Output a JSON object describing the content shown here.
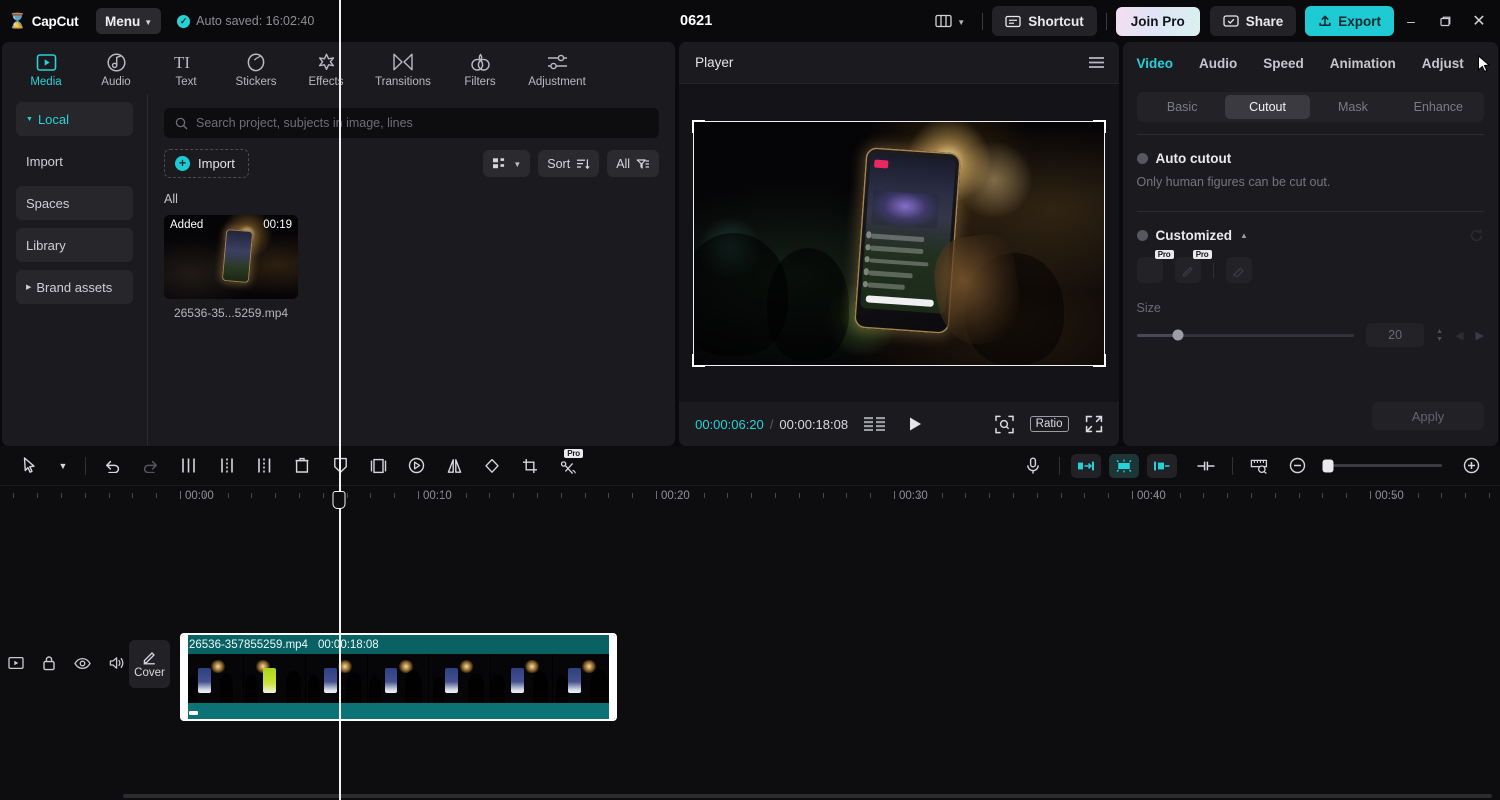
{
  "topbar": {
    "app_name": "CapCut",
    "menu_label": "Menu",
    "autosave": "Auto saved: 16:02:40",
    "project_title": "0621",
    "layout_icon": "layout-icon",
    "shortcut_label": "Shortcut",
    "join_pro_label": "Join Pro",
    "share_label": "Share",
    "export_label": "Export",
    "minimize_icon": "minimize-icon",
    "maximize_icon": "maximize-icon",
    "close_icon": "close-icon"
  },
  "categories": [
    {
      "label": "Media",
      "icon": "media-icon",
      "active": true
    },
    {
      "label": "Audio",
      "icon": "audio-icon",
      "active": false
    },
    {
      "label": "Text",
      "icon": "text-icon",
      "active": false
    },
    {
      "label": "Stickers",
      "icon": "stickers-icon",
      "active": false
    },
    {
      "label": "Effects",
      "icon": "effects-icon",
      "active": false
    },
    {
      "label": "Transitions",
      "icon": "transitions-icon",
      "active": false
    },
    {
      "label": "Filters",
      "icon": "filters-icon",
      "active": false
    },
    {
      "label": "Adjustment",
      "icon": "adjustment-icon",
      "active": false
    }
  ],
  "sidenav": [
    {
      "label": "Local",
      "selected": true,
      "expandable": true
    },
    {
      "label": "Import",
      "selected": false,
      "expandable": false
    },
    {
      "label": "Spaces",
      "selected": false,
      "expandable": false
    },
    {
      "label": "Library",
      "selected": false,
      "expandable": false
    },
    {
      "label": "Brand assets",
      "selected": false,
      "expandable": true
    }
  ],
  "media": {
    "search_placeholder": "Search project, subjects in image, lines",
    "import_label": "Import",
    "view_label": "grid-view-icon",
    "sort_label": "Sort",
    "filter_label": "All",
    "group_label": "All",
    "items": [
      {
        "badge": "Added",
        "duration": "00:19",
        "name": "26536-35...5259.mp4"
      }
    ]
  },
  "player": {
    "title": "Player",
    "menu_icon": "hamburger-icon",
    "current_time": "00:00:06:20",
    "separator": "/",
    "total_time": "00:00:18:08",
    "frames_icon": "frames-icon",
    "play_icon": "play-icon",
    "zoom_icon": "zoom-fit-icon",
    "ratio_label": "Ratio",
    "fullscreen_icon": "fullscreen-icon"
  },
  "inspector": {
    "tabs": [
      {
        "label": "Video",
        "active": true
      },
      {
        "label": "Audio",
        "active": false
      },
      {
        "label": "Speed",
        "active": false
      },
      {
        "label": "Animation",
        "active": false
      },
      {
        "label": "Adjust",
        "active": false
      }
    ],
    "segments": [
      {
        "label": "Basic",
        "on": false
      },
      {
        "label": "Cutout",
        "on": true
      },
      {
        "label": "Mask",
        "on": false
      },
      {
        "label": "Enhance",
        "on": false
      }
    ],
    "auto_cutout_label": "Auto cutout",
    "auto_cutout_note": "Only human figures can be cut out.",
    "customized_label": "Customized",
    "pro_badge": "Pro",
    "size_label": "Size",
    "size_value": "20",
    "apply_label": "Apply"
  },
  "timeline": {
    "tools_left": [
      "select-icon",
      "chevron-down-icon",
      "undo-icon",
      "redo-icon",
      "split-icon",
      "trim-left-icon",
      "trim-right-icon",
      "delete-icon",
      "keyframe-icon",
      "freeze-icon",
      "speed-icon",
      "mirror-icon",
      "rotate-icon",
      "crop-icon",
      "auto-cut-pro-icon"
    ],
    "tools_right": [
      "microphone-icon",
      "snap-left-icon",
      "magnet-icon",
      "snap-right-icon",
      "link-icon",
      "ruler-icon",
      "zoom-out-icon",
      "zoom-in-icon"
    ],
    "ruler_labels": [
      "00:00",
      "00:10",
      "00:20",
      "00:30",
      "00:40",
      "00:50"
    ],
    "track_controls": [
      "track-toggle-icon",
      "lock-icon",
      "eye-icon",
      "volume-icon"
    ],
    "cover_label": "Cover",
    "clip": {
      "name": "26536-357855259.mp4",
      "duration": "00:00:18:08"
    }
  }
}
